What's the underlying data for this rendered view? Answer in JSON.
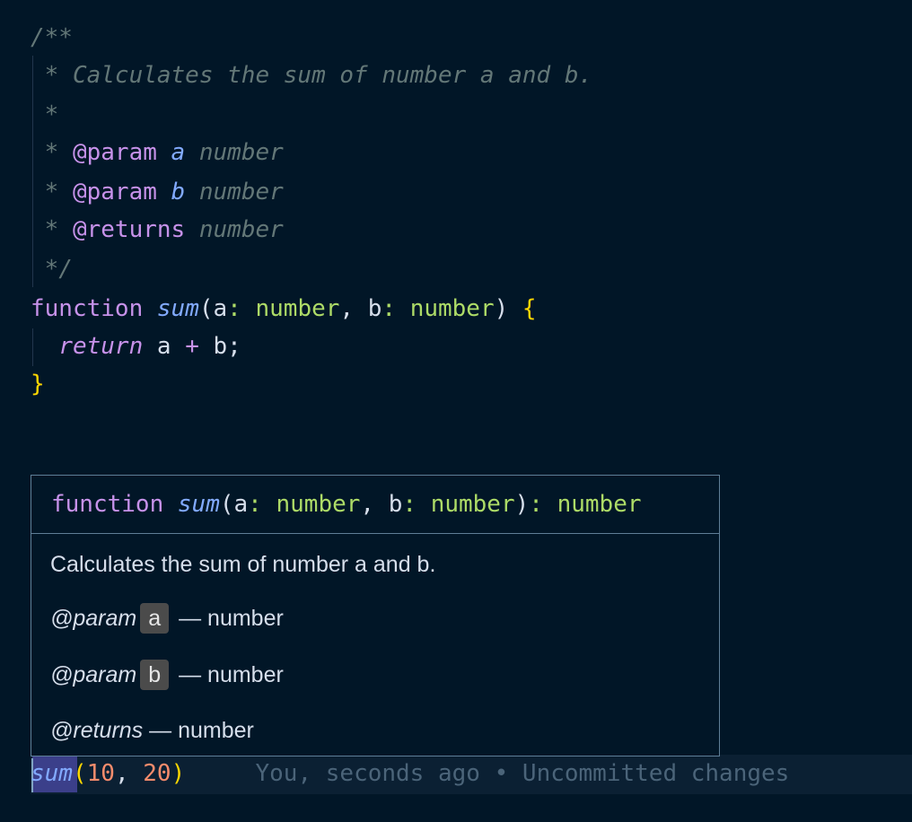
{
  "code": {
    "doc_open": "/**",
    "doc_summary": " * Calculates the sum of number a and b.",
    "doc_blank": " *",
    "param1": {
      "prefix": " * ",
      "tag": "@param",
      "name": "a",
      "type": "number"
    },
    "param2": {
      "prefix": " * ",
      "tag": "@param",
      "name": "b",
      "type": "number"
    },
    "returns": {
      "prefix": " * ",
      "tag": "@returns",
      "type": "number"
    },
    "doc_close": " */",
    "fn_keyword": "function",
    "fn_name": "sum",
    "param_a": "a",
    "param_b": "b",
    "type_number": "number",
    "return_keyword": "return",
    "return_expr_a": "a",
    "return_op": "+",
    "return_expr_b": "b;",
    "call_name": "sum",
    "call_arg1": "10",
    "call_arg2": "20",
    "blame": "You, seconds ago • Uncommitted changes"
  },
  "hover": {
    "sig_keyword": "function",
    "sig_name": "sum",
    "sig_param_a": "a",
    "sig_param_b": "b",
    "sig_type": "number",
    "summary": "Calculates the sum of number a and b.",
    "param_tag": "@param",
    "param_a": "a",
    "param_b": "b",
    "returns_tag": "@returns",
    "dash_type": " — number"
  },
  "colors": {
    "background": "#011627",
    "keyword": "#c792ea",
    "function": "#82aaff",
    "type": "#addb67",
    "comment": "#637777",
    "bracket": "#ffd700",
    "number": "#f78c6c"
  }
}
